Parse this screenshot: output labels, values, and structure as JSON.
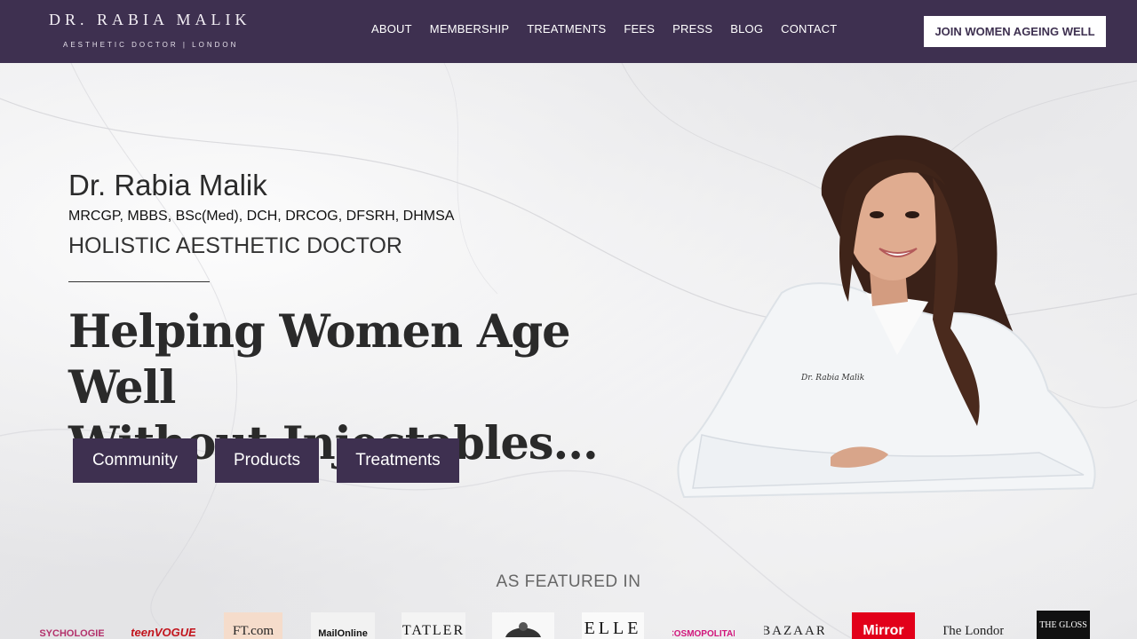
{
  "header": {
    "logo_title": "DR. RABIA MALIK",
    "logo_subtitle": "AESTHETIC DOCTOR | LONDON",
    "nav": [
      "ABOUT",
      "MEMBERSHIP",
      "TREATMENTS",
      "FEES",
      "PRESS",
      "BLOG",
      "CONTACT"
    ],
    "cta_label": "JOIN WOMEN AGEING WELL"
  },
  "hero": {
    "name": "Dr. Rabia Malik",
    "qualifications": "MRCGP, MBBS, BSc(Med), DCH, DRCOG, DFSRH, DHMSA",
    "role": "HOLISTIC AESTHETIC DOCTOR",
    "headline_line1": "Helping Women Age Well",
    "headline_line2": "Without Injectables...",
    "buttons": [
      "Community",
      "Products",
      "Treatments"
    ],
    "coat_embroidery": "Dr. Rabia Malik"
  },
  "featured": {
    "heading": "AS FEATURED IN",
    "logos": [
      "PSYCHOLOGIES",
      "teenVOGUE",
      "FT.com",
      "MailOnline",
      "TATLER",
      "crest",
      "ELLE",
      "COSMOPOLITAN",
      "BAZAAR",
      "Mirror",
      "The London",
      "THE GLOSS"
    ]
  },
  "colors": {
    "brand_purple": "#3e3050",
    "button_text": "#ffffff",
    "marble": "#ececec"
  }
}
